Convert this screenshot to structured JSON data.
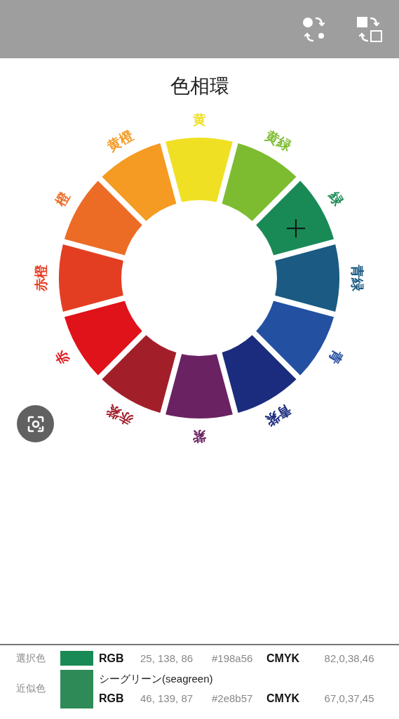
{
  "title": "色相環",
  "wheel": {
    "segments": [
      {
        "label": "黄",
        "color": "#f0e024",
        "selected": false
      },
      {
        "label": "黄緑",
        "color": "#7dbc30",
        "selected": false
      },
      {
        "label": "緑",
        "color": "#198a56",
        "selected": true
      },
      {
        "label": "青緑",
        "color": "#1b5a82",
        "selected": false
      },
      {
        "label": "青",
        "color": "#2450a2",
        "selected": false
      },
      {
        "label": "青紫",
        "color": "#1b2c7e",
        "selected": false
      },
      {
        "label": "紫",
        "color": "#6a2262",
        "selected": false
      },
      {
        "label": "赤紫",
        "color": "#a21f2a",
        "selected": false
      },
      {
        "label": "赤",
        "color": "#e0121a",
        "selected": false
      },
      {
        "label": "赤橙",
        "color": "#e43e22",
        "selected": false
      },
      {
        "label": "橙",
        "color": "#ec6c26",
        "selected": false
      },
      {
        "label": "黄橙",
        "color": "#f59a22",
        "selected": false
      }
    ]
  },
  "info_rows": [
    {
      "label": "選択色",
      "color": "#198a56",
      "rgb_label": "RGB",
      "rgb": "25, 138, 86",
      "hex": "#198a56",
      "cmyk_label": "CMYK",
      "cmyk": "82,0,38,46"
    },
    {
      "label": "近似色",
      "color": "#2e8b57",
      "name": "シーグリーン(seagreen)",
      "rgb_label": "RGB",
      "rgb": "46, 139, 87",
      "hex": "#2e8b57",
      "cmyk_label": "CMYK",
      "cmyk": "67,0,37,45"
    }
  ]
}
